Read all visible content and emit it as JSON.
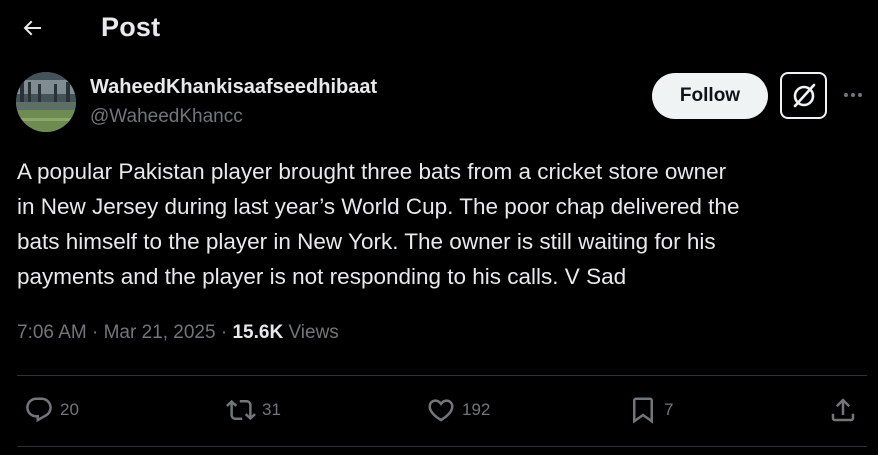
{
  "header": {
    "title": "Post",
    "back_icon": "arrow-left-icon"
  },
  "author": {
    "display_name": "WaheedKhankisaafseedhibaat",
    "handle": "@WaheedKhancc",
    "follow_label": "Follow"
  },
  "post": {
    "lines": [
      "A popular Pakistan player brought three bats from a cricket store owner",
      "in New Jersey during last year’s World Cup. The poor chap delivered the",
      "bats himself to the player in New York. The owner is still waiting for his",
      "payments and the player is not responding to his calls. V Sad"
    ]
  },
  "meta": {
    "time": "7:06 AM",
    "separator": "·",
    "date": "Mar 21, 2025",
    "views_count": "15.6K",
    "views_label": "Views"
  },
  "actions": {
    "replies": "20",
    "reposts": "31",
    "likes": "192",
    "bookmarks": "7"
  },
  "colors": {
    "background": "#000000",
    "text_primary": "#e7e9ea",
    "text_secondary": "#71767b",
    "divider": "#2f3336",
    "follow_bg": "#eff3f4"
  }
}
